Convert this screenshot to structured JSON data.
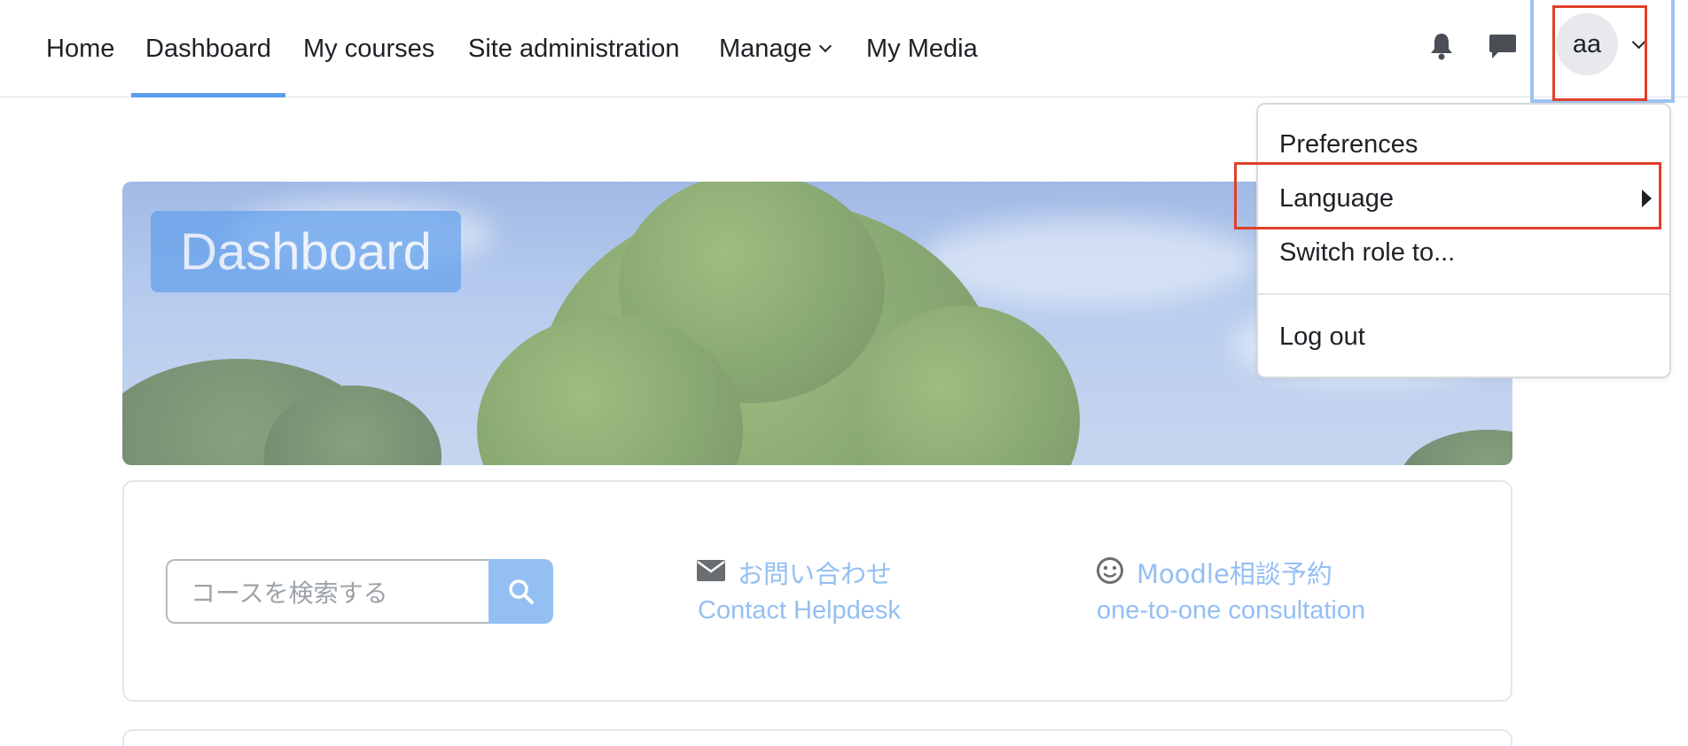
{
  "nav": {
    "items": [
      {
        "label": "Home"
      },
      {
        "label": "Dashboard",
        "active": true
      },
      {
        "label": "My courses"
      },
      {
        "label": "Site administration"
      },
      {
        "label": "Manage",
        "has_dropdown": true
      },
      {
        "label": "My Media"
      }
    ],
    "icons": [
      "bell-icon",
      "chat-icon"
    ],
    "user_initials": "aa"
  },
  "banner": {
    "title": "Dashboard"
  },
  "search": {
    "placeholder": "コースを検索する",
    "icon": "search-icon"
  },
  "links": {
    "contact_jp": "お問い合わせ",
    "contact_en": "Contact  Helpdesk",
    "contact_icon": "envelope-icon",
    "consult_jp": "Moodle相談予約",
    "consult_en": "one-to-one consultation",
    "consult_icon": "smile-icon"
  },
  "user_menu": {
    "items": [
      {
        "label": "Preferences"
      },
      {
        "label": "Language",
        "has_submenu": true
      },
      {
        "label": "Switch role to..."
      }
    ],
    "logout": "Log out"
  },
  "colors": {
    "accent": "#5b9ded",
    "highlight": "#e0402a",
    "focus_outline": "#9cc3f0"
  }
}
